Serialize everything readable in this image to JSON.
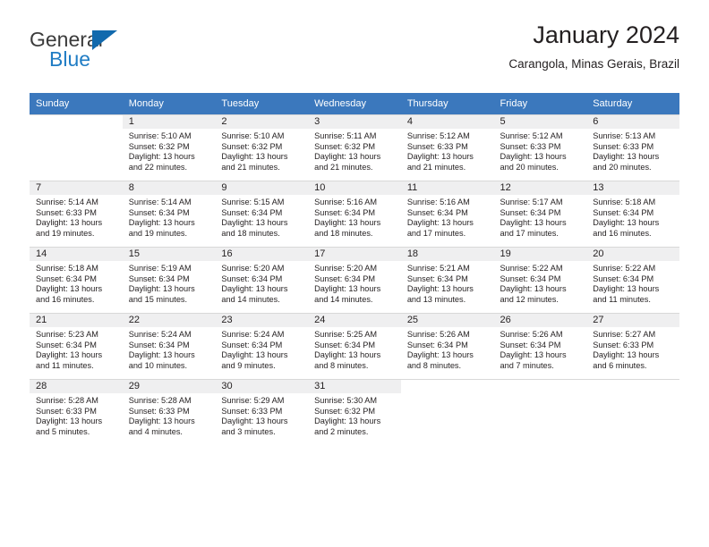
{
  "brand": {
    "name_part1": "General",
    "name_part2": "Blue",
    "accent_color": "#1f7cc4",
    "triangle_icon": "brand-triangle-icon"
  },
  "header": {
    "title": "January 2024",
    "subtitle": "Carangola, Minas Gerais, Brazil"
  },
  "calendar": {
    "header_bg": "#3b78bd",
    "daynum_bg": "#efeff0",
    "weekdays": [
      "Sunday",
      "Monday",
      "Tuesday",
      "Wednesday",
      "Thursday",
      "Friday",
      "Saturday"
    ],
    "weeks": [
      [
        {
          "day": "",
          "sunrise": "",
          "sunset": "",
          "daylight1": "",
          "daylight2": ""
        },
        {
          "day": "1",
          "sunrise": "Sunrise: 5:10 AM",
          "sunset": "Sunset: 6:32 PM",
          "daylight1": "Daylight: 13 hours",
          "daylight2": "and 22 minutes."
        },
        {
          "day": "2",
          "sunrise": "Sunrise: 5:10 AM",
          "sunset": "Sunset: 6:32 PM",
          "daylight1": "Daylight: 13 hours",
          "daylight2": "and 21 minutes."
        },
        {
          "day": "3",
          "sunrise": "Sunrise: 5:11 AM",
          "sunset": "Sunset: 6:32 PM",
          "daylight1": "Daylight: 13 hours",
          "daylight2": "and 21 minutes."
        },
        {
          "day": "4",
          "sunrise": "Sunrise: 5:12 AM",
          "sunset": "Sunset: 6:33 PM",
          "daylight1": "Daylight: 13 hours",
          "daylight2": "and 21 minutes."
        },
        {
          "day": "5",
          "sunrise": "Sunrise: 5:12 AM",
          "sunset": "Sunset: 6:33 PM",
          "daylight1": "Daylight: 13 hours",
          "daylight2": "and 20 minutes."
        },
        {
          "day": "6",
          "sunrise": "Sunrise: 5:13 AM",
          "sunset": "Sunset: 6:33 PM",
          "daylight1": "Daylight: 13 hours",
          "daylight2": "and 20 minutes."
        }
      ],
      [
        {
          "day": "7",
          "sunrise": "Sunrise: 5:14 AM",
          "sunset": "Sunset: 6:33 PM",
          "daylight1": "Daylight: 13 hours",
          "daylight2": "and 19 minutes."
        },
        {
          "day": "8",
          "sunrise": "Sunrise: 5:14 AM",
          "sunset": "Sunset: 6:34 PM",
          "daylight1": "Daylight: 13 hours",
          "daylight2": "and 19 minutes."
        },
        {
          "day": "9",
          "sunrise": "Sunrise: 5:15 AM",
          "sunset": "Sunset: 6:34 PM",
          "daylight1": "Daylight: 13 hours",
          "daylight2": "and 18 minutes."
        },
        {
          "day": "10",
          "sunrise": "Sunrise: 5:16 AM",
          "sunset": "Sunset: 6:34 PM",
          "daylight1": "Daylight: 13 hours",
          "daylight2": "and 18 minutes."
        },
        {
          "day": "11",
          "sunrise": "Sunrise: 5:16 AM",
          "sunset": "Sunset: 6:34 PM",
          "daylight1": "Daylight: 13 hours",
          "daylight2": "and 17 minutes."
        },
        {
          "day": "12",
          "sunrise": "Sunrise: 5:17 AM",
          "sunset": "Sunset: 6:34 PM",
          "daylight1": "Daylight: 13 hours",
          "daylight2": "and 17 minutes."
        },
        {
          "day": "13",
          "sunrise": "Sunrise: 5:18 AM",
          "sunset": "Sunset: 6:34 PM",
          "daylight1": "Daylight: 13 hours",
          "daylight2": "and 16 minutes."
        }
      ],
      [
        {
          "day": "14",
          "sunrise": "Sunrise: 5:18 AM",
          "sunset": "Sunset: 6:34 PM",
          "daylight1": "Daylight: 13 hours",
          "daylight2": "and 16 minutes."
        },
        {
          "day": "15",
          "sunrise": "Sunrise: 5:19 AM",
          "sunset": "Sunset: 6:34 PM",
          "daylight1": "Daylight: 13 hours",
          "daylight2": "and 15 minutes."
        },
        {
          "day": "16",
          "sunrise": "Sunrise: 5:20 AM",
          "sunset": "Sunset: 6:34 PM",
          "daylight1": "Daylight: 13 hours",
          "daylight2": "and 14 minutes."
        },
        {
          "day": "17",
          "sunrise": "Sunrise: 5:20 AM",
          "sunset": "Sunset: 6:34 PM",
          "daylight1": "Daylight: 13 hours",
          "daylight2": "and 14 minutes."
        },
        {
          "day": "18",
          "sunrise": "Sunrise: 5:21 AM",
          "sunset": "Sunset: 6:34 PM",
          "daylight1": "Daylight: 13 hours",
          "daylight2": "and 13 minutes."
        },
        {
          "day": "19",
          "sunrise": "Sunrise: 5:22 AM",
          "sunset": "Sunset: 6:34 PM",
          "daylight1": "Daylight: 13 hours",
          "daylight2": "and 12 minutes."
        },
        {
          "day": "20",
          "sunrise": "Sunrise: 5:22 AM",
          "sunset": "Sunset: 6:34 PM",
          "daylight1": "Daylight: 13 hours",
          "daylight2": "and 11 minutes."
        }
      ],
      [
        {
          "day": "21",
          "sunrise": "Sunrise: 5:23 AM",
          "sunset": "Sunset: 6:34 PM",
          "daylight1": "Daylight: 13 hours",
          "daylight2": "and 11 minutes."
        },
        {
          "day": "22",
          "sunrise": "Sunrise: 5:24 AM",
          "sunset": "Sunset: 6:34 PM",
          "daylight1": "Daylight: 13 hours",
          "daylight2": "and 10 minutes."
        },
        {
          "day": "23",
          "sunrise": "Sunrise: 5:24 AM",
          "sunset": "Sunset: 6:34 PM",
          "daylight1": "Daylight: 13 hours",
          "daylight2": "and 9 minutes."
        },
        {
          "day": "24",
          "sunrise": "Sunrise: 5:25 AM",
          "sunset": "Sunset: 6:34 PM",
          "daylight1": "Daylight: 13 hours",
          "daylight2": "and 8 minutes."
        },
        {
          "day": "25",
          "sunrise": "Sunrise: 5:26 AM",
          "sunset": "Sunset: 6:34 PM",
          "daylight1": "Daylight: 13 hours",
          "daylight2": "and 8 minutes."
        },
        {
          "day": "26",
          "sunrise": "Sunrise: 5:26 AM",
          "sunset": "Sunset: 6:34 PM",
          "daylight1": "Daylight: 13 hours",
          "daylight2": "and 7 minutes."
        },
        {
          "day": "27",
          "sunrise": "Sunrise: 5:27 AM",
          "sunset": "Sunset: 6:33 PM",
          "daylight1": "Daylight: 13 hours",
          "daylight2": "and 6 minutes."
        }
      ],
      [
        {
          "day": "28",
          "sunrise": "Sunrise: 5:28 AM",
          "sunset": "Sunset: 6:33 PM",
          "daylight1": "Daylight: 13 hours",
          "daylight2": "and 5 minutes."
        },
        {
          "day": "29",
          "sunrise": "Sunrise: 5:28 AM",
          "sunset": "Sunset: 6:33 PM",
          "daylight1": "Daylight: 13 hours",
          "daylight2": "and 4 minutes."
        },
        {
          "day": "30",
          "sunrise": "Sunrise: 5:29 AM",
          "sunset": "Sunset: 6:33 PM",
          "daylight1": "Daylight: 13 hours",
          "daylight2": "and 3 minutes."
        },
        {
          "day": "31",
          "sunrise": "Sunrise: 5:30 AM",
          "sunset": "Sunset: 6:32 PM",
          "daylight1": "Daylight: 13 hours",
          "daylight2": "and 2 minutes."
        },
        {
          "day": "",
          "sunrise": "",
          "sunset": "",
          "daylight1": "",
          "daylight2": ""
        },
        {
          "day": "",
          "sunrise": "",
          "sunset": "",
          "daylight1": "",
          "daylight2": ""
        },
        {
          "day": "",
          "sunrise": "",
          "sunset": "",
          "daylight1": "",
          "daylight2": ""
        }
      ]
    ]
  }
}
